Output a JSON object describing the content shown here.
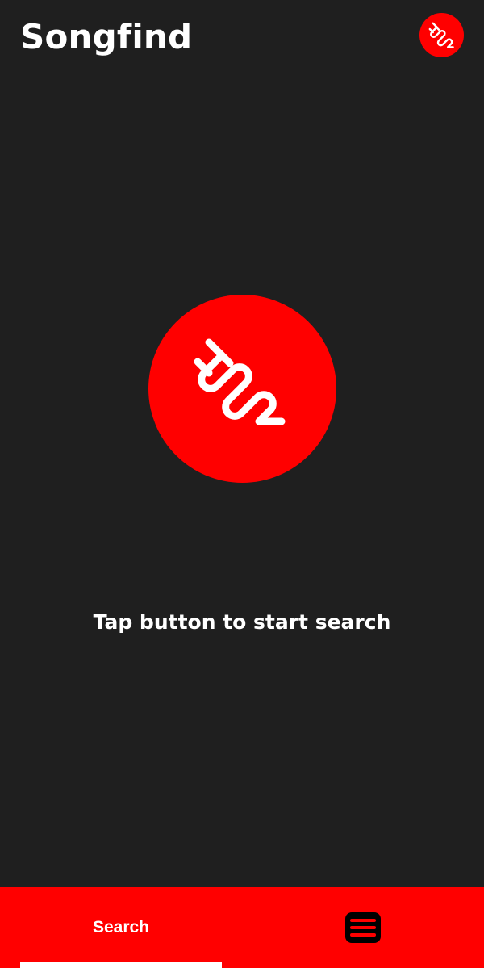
{
  "app": {
    "title": "Songfind",
    "background_color": "#1f1f1f",
    "accent_color": "#ff0000"
  },
  "header": {
    "logo_icon": "wave-logo-icon"
  },
  "main": {
    "search_button_icon": "wave-logo-icon",
    "hint": "Tap button to start search"
  },
  "bottom_nav": {
    "tabs": [
      {
        "label": "Search",
        "active": true
      },
      {
        "label": "",
        "icon": "list-icon",
        "active": false
      }
    ]
  }
}
